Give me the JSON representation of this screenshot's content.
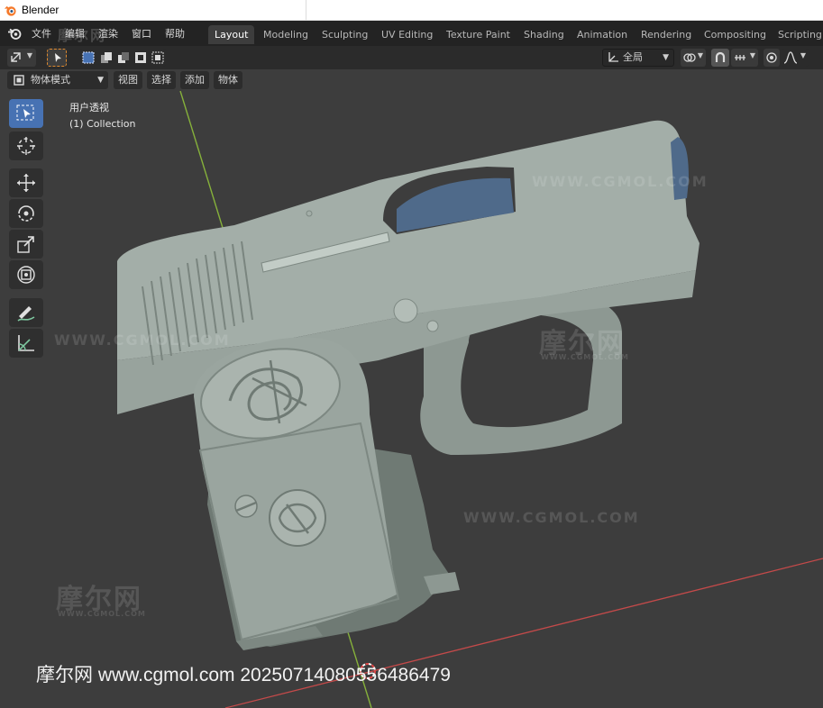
{
  "window": {
    "title": "Blender"
  },
  "menubar": {
    "items": [
      "文件",
      "编辑",
      "渲染",
      "窗口",
      "帮助"
    ],
    "workspaces": [
      "Layout",
      "Modeling",
      "Sculpting",
      "UV Editing",
      "Texture Paint",
      "Shading",
      "Animation",
      "Rendering",
      "Compositing",
      "Scripting"
    ],
    "active_workspace": "Layout"
  },
  "header": {
    "transform_orientation": "全局",
    "icons": [
      "editor-type-icon",
      "select-tool-icon",
      "select-mode-new-icon",
      "select-mode-extend-icon",
      "select-mode-subtract-icon",
      "select-mode-invert-icon",
      "select-mode-intersect-icon",
      "transform-pivot-icon",
      "snap-icon",
      "snap-increment-icon",
      "proportional-edit-icon",
      "falloff-icon"
    ]
  },
  "subheader": {
    "mode": "物体模式",
    "menus": [
      "视图",
      "选择",
      "添加",
      "物体"
    ]
  },
  "toolbar": {
    "tools": [
      "select-box",
      "cursor",
      "move",
      "rotate",
      "scale",
      "transform",
      "annotate",
      "measure"
    ],
    "active": "select-box"
  },
  "viewport": {
    "view_name": "用户透视",
    "collection": "(1) Collection"
  },
  "watermarks": {
    "url": "WWW.CGMOL.COM",
    "brand": "摩尔网",
    "brand_sub": "WWW.CGMOL.COM"
  },
  "caption": "摩尔网 www.cgmol.com 20250714080556486479",
  "colors": {
    "viewport_bg": "#3d3d3d",
    "active_tab": "#3d3d3d",
    "accent": "#4772b3",
    "model": "#9aa59f",
    "model_shadow": "#6f7a74",
    "barrel": "#4f6a8a",
    "axis_y": "#86b13b",
    "axis_x": "#c44a4a"
  }
}
